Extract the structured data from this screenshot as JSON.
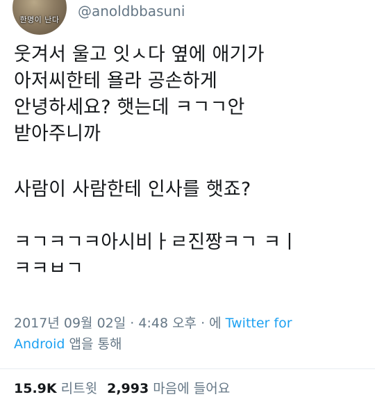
{
  "author": {
    "handle": "@anoldbbasuni",
    "avatar_caption": "한명이 난다"
  },
  "tweet": {
    "lines": [
      "웃겨서 울고 잇ㅅ다 옆에 애기가",
      "아저씨한테 욜라 공손하게",
      "안녕하세요? 햇는데  ㅋㄱㄱ안",
      "받아주니까",
      "사람이 사람한테 인사를 햇죠?",
      "ㅋㄱㅋㄱㅋ아시비ㅏㄹ진짱ㅋㄱ ㅋㅣ",
      "ㅋㅋㅂㄱ"
    ]
  },
  "meta": {
    "date": "2017년 09월 02일",
    "separator": " · ",
    "time": "4:48 오후",
    "via_prefix": " · 에 ",
    "source_line1": "Twitter for",
    "source_line2": "Android",
    "via_suffix": " 앱을 통해"
  },
  "stats": {
    "retweets_count": "15.9K",
    "retweets_label": "리트윗",
    "likes_count": "2,993",
    "likes_label": "마음에 들어요"
  },
  "colors": {
    "text": "#14171a",
    "secondary": "#657786",
    "link": "#1da1f2"
  }
}
